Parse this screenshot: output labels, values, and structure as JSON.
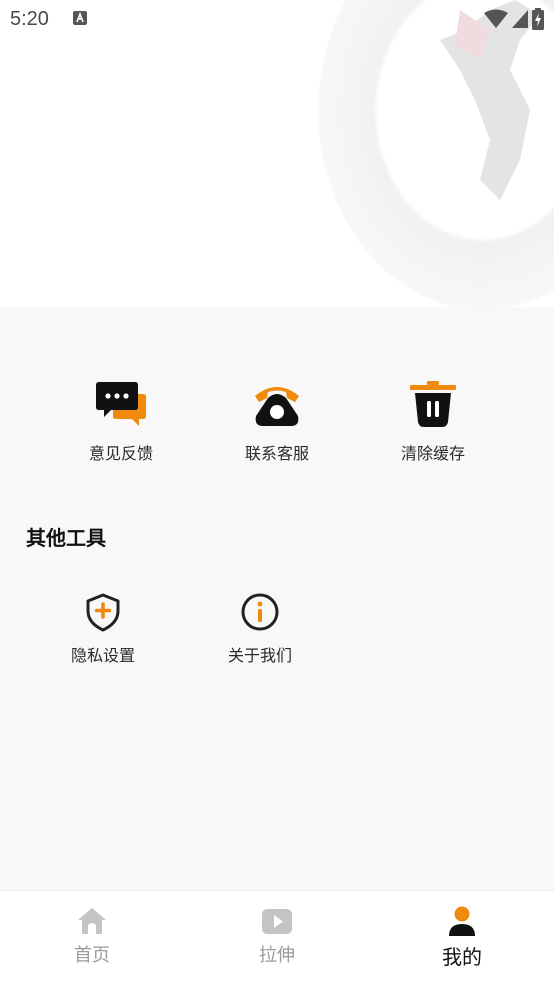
{
  "status_bar": {
    "time": "5:20"
  },
  "actions": [
    {
      "label": "意见反馈",
      "icon": "feedback-chat-icon"
    },
    {
      "label": "联系客服",
      "icon": "telephone-icon"
    },
    {
      "label": "清除缓存",
      "icon": "trash-can-icon"
    }
  ],
  "tools": {
    "title": "其他工具",
    "items": [
      {
        "label": "隐私设置",
        "icon": "shield-plus-icon"
      },
      {
        "label": "关于我们",
        "icon": "info-circle-icon"
      }
    ]
  },
  "tabbar": {
    "tabs": [
      {
        "label": "首页",
        "icon": "home-icon",
        "active": false
      },
      {
        "label": "拉伸",
        "icon": "video-play-icon",
        "active": false
      },
      {
        "label": "我的",
        "icon": "person-icon",
        "active": true
      }
    ]
  },
  "colors": {
    "accent": "#f08a0c",
    "dark": "#111111",
    "inactive": "#bfbfbf",
    "background": "#f8f8f8"
  }
}
